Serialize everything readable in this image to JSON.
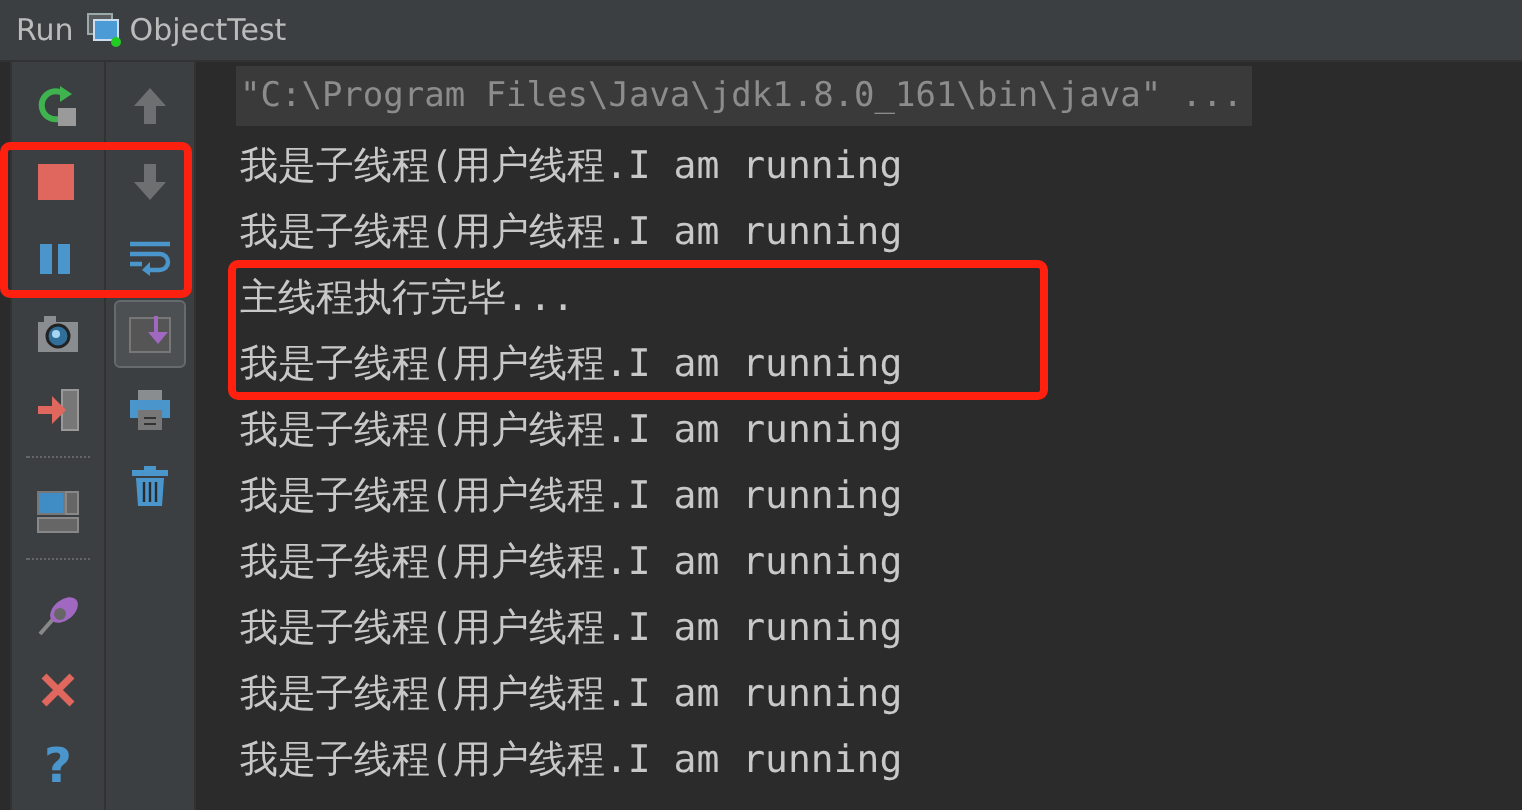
{
  "window": {
    "title": "Run",
    "tab": "ObjectTest"
  },
  "toolbar_left": [
    {
      "kind": "rerun",
      "marked": false
    },
    {
      "kind": "stop",
      "marked": true
    },
    {
      "kind": "pause",
      "marked": true
    },
    {
      "kind": "camera",
      "marked": false
    },
    {
      "kind": "exit",
      "marked": false
    },
    {
      "kind": "separator"
    },
    {
      "kind": "layout",
      "marked": false
    },
    {
      "kind": "separator"
    },
    {
      "kind": "pin",
      "marked": false
    },
    {
      "kind": "close",
      "marked": false
    },
    {
      "kind": "help",
      "label": "?",
      "marked": false
    }
  ],
  "toolbar_right": [
    {
      "kind": "up",
      "disabled": true,
      "selected": false
    },
    {
      "kind": "down",
      "disabled": true,
      "selected": false
    },
    {
      "kind": "wrap",
      "disabled": false,
      "selected": false
    },
    {
      "kind": "scroll-end",
      "disabled": false,
      "selected": true
    },
    {
      "kind": "print",
      "disabled": false,
      "selected": false
    },
    {
      "kind": "trash",
      "disabled": false,
      "selected": false
    }
  ],
  "console": {
    "command": "\"C:\\Program Files\\Java\\jdk1.8.0_161\\bin\\java\" ...",
    "lines": [
      {
        "text": "我是子线程(用户线程.I am running",
        "marked": false
      },
      {
        "text": "我是子线程(用户线程.I am running",
        "marked": false
      },
      {
        "text": "主线程执行完毕...",
        "marked": true
      },
      {
        "text": "我是子线程(用户线程.I am running",
        "marked": true
      },
      {
        "text": "我是子线程(用户线程.I am running",
        "marked": false
      },
      {
        "text": "我是子线程(用户线程.I am running",
        "marked": false
      },
      {
        "text": "我是子线程(用户线程.I am running",
        "marked": false
      },
      {
        "text": "我是子线程(用户线程.I am running",
        "marked": false
      },
      {
        "text": "我是子线程(用户线程.I am running",
        "marked": false
      },
      {
        "text": "我是子线程(用户线程.I am running",
        "marked": false
      }
    ]
  }
}
